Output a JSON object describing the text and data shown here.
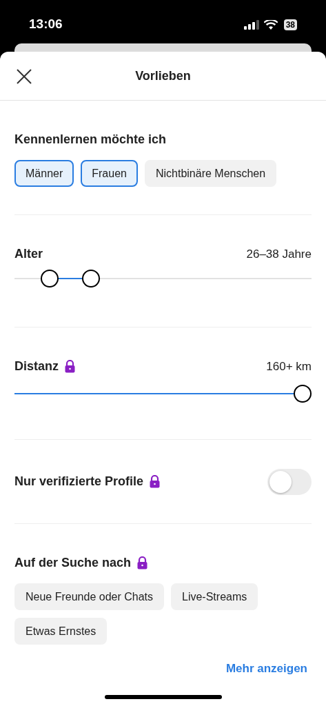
{
  "status_bar": {
    "time": "13:06",
    "battery": "38"
  },
  "header": {
    "title": "Vorlieben"
  },
  "sections": [
    {
      "kind": "chips",
      "title": "Kennenlernen möchte ich",
      "locked": false,
      "chips": [
        {
          "label": "Männer",
          "selected": true
        },
        {
          "label": "Frauen",
          "selected": true
        },
        {
          "label": "Nichtbinäre Menschen",
          "selected": false
        }
      ]
    },
    {
      "kind": "range",
      "title": "Alter",
      "locked": false,
      "reading": "26–38 Jahre",
      "thumbs": [
        {
          "level": 0.094
        },
        {
          "level": 0.242
        }
      ]
    },
    {
      "kind": "slider",
      "title": "Distanz",
      "locked": true,
      "reading": "160+ km",
      "level": 1
    },
    {
      "kind": "toggle",
      "title": "Nur verifizierte Profile",
      "locked": true,
      "on": false
    },
    {
      "kind": "chips",
      "title": "Auf der Suche nach",
      "locked": true,
      "chips": [
        {
          "label": "Neue Freunde oder Chats",
          "selected": false
        },
        {
          "label": "Live-Streams",
          "selected": false
        },
        {
          "label": "Etwas Ernstes",
          "selected": false
        }
      ],
      "link": "Mehr anzeigen"
    }
  ]
}
